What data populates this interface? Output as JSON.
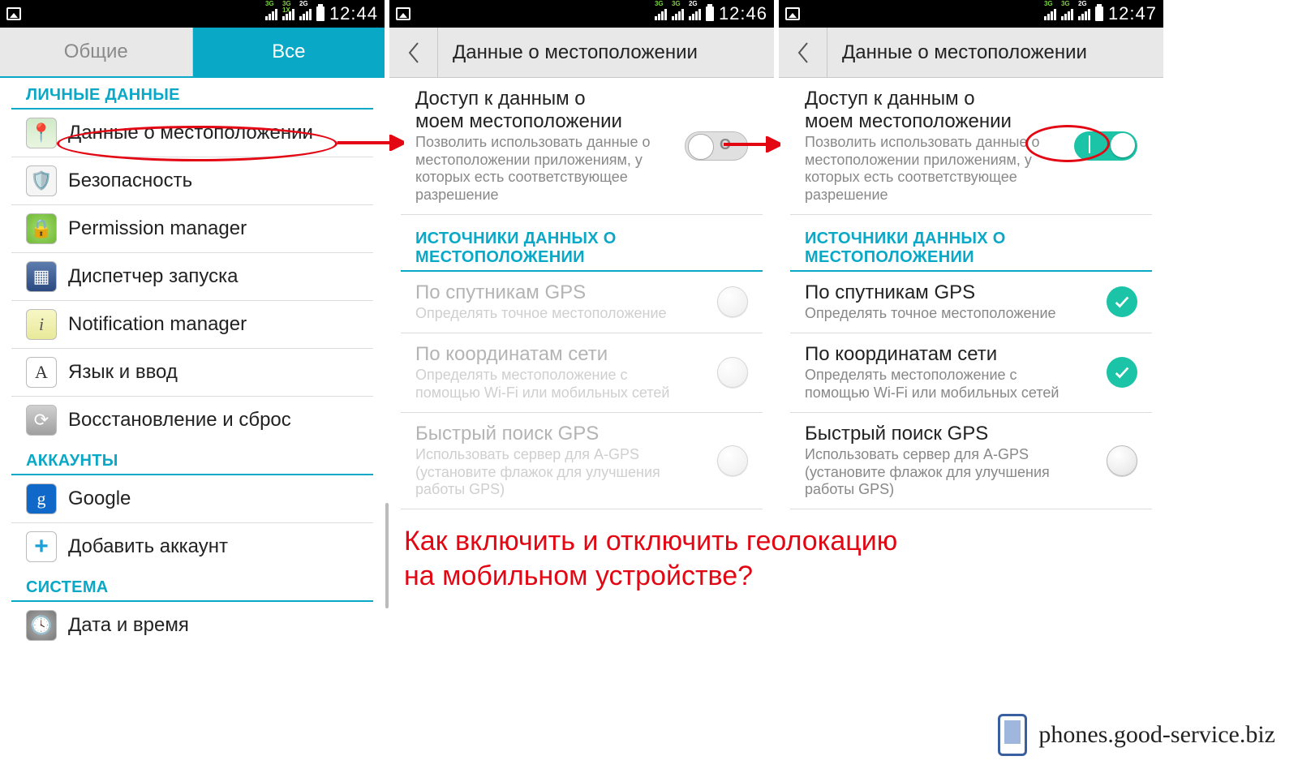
{
  "status": {
    "times": [
      "12:44",
      "12:46",
      "12:47"
    ],
    "net_3g": "3G",
    "net_1x": "1X",
    "net_2g": "2G"
  },
  "screen1": {
    "tab_general": "Общие",
    "tab_all": "Все",
    "sections": {
      "personal": "ЛИЧНЫЕ ДАННЫЕ",
      "accounts": "АККАУНТЫ",
      "system": "СИСТЕМА"
    },
    "items": {
      "location": "Данные о местоположении",
      "security": "Безопасность",
      "permission": "Permission manager",
      "launcher": "Диспетчер запуска",
      "notification": "Notification manager",
      "language": "Язык и ввод",
      "reset": "Восстановление и сброс",
      "google": "Google",
      "add_account": "Добавить аккаунт",
      "datetime": "Дата и время"
    }
  },
  "location": {
    "title": "Данные о местоположении",
    "access_title_l1": "Доступ к данным о",
    "access_title_l2": "моем местоположении",
    "access_sub": "Позволить использовать данные о местоположении приложениям, у которых есть соответствующее разрешение",
    "sources_header": "ИСТОЧНИКИ ДАННЫХ О МЕСТОПОЛОЖЕНИИ",
    "gps_title": "По спутникам GPS",
    "gps_sub": "Определять точное местоположение",
    "net_title": "По координатам сети",
    "net_sub": "Определять местоположение с помощью Wi-Fi или мобильных сетей",
    "agps_title": "Быстрый поиск GPS",
    "agps_sub": "Использовать сервер для A-GPS (установите флажок для улучшения работы GPS)"
  },
  "caption_l1": "Как включить и отключить геолокацию",
  "caption_l2": "на мобильном устройстве?",
  "footer": "phones.good-service.biz"
}
